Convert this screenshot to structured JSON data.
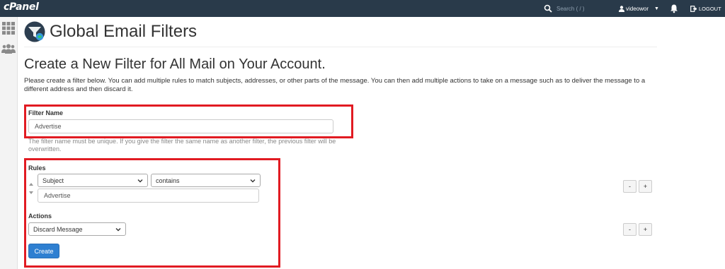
{
  "topbar": {
    "logo": "cPanel",
    "search_placeholder": "Search ( / )",
    "username": "videowor",
    "logout": "LOGOUT"
  },
  "page": {
    "title": "Global Email Filters",
    "section_title": "Create a New Filter for All Mail on Your Account.",
    "intro": "Please create a filter below. You can add multiple rules to match subjects, addresses, or other parts of the message. You can then add multiple actions to take on a message such as to deliver the message to a different address and then discard it."
  },
  "filter": {
    "name_label": "Filter Name",
    "name_value": "Advertise",
    "help": "The filter name must be unique. If you give the filter the same name as another filter, the previous filter will be overwritten."
  },
  "rules": {
    "label": "Rules",
    "part": "Subject",
    "match": "contains",
    "value": "Advertise",
    "minus": "-",
    "plus": "+"
  },
  "actions": {
    "label": "Actions",
    "selected": "Discard Message",
    "minus": "-",
    "plus": "+"
  },
  "create_label": "Create",
  "colors": {
    "topbar": "#293a4a",
    "primary_button": "#2e7fd1",
    "highlight": "#e11b22"
  },
  "icons": [
    "search-icon",
    "user-icon",
    "caret-down-icon",
    "bell-icon",
    "logout-icon",
    "apps-grid-icon",
    "users-icon",
    "email-filter-icon",
    "chevron-down-icon",
    "sort-up-icon",
    "sort-down-icon"
  ]
}
